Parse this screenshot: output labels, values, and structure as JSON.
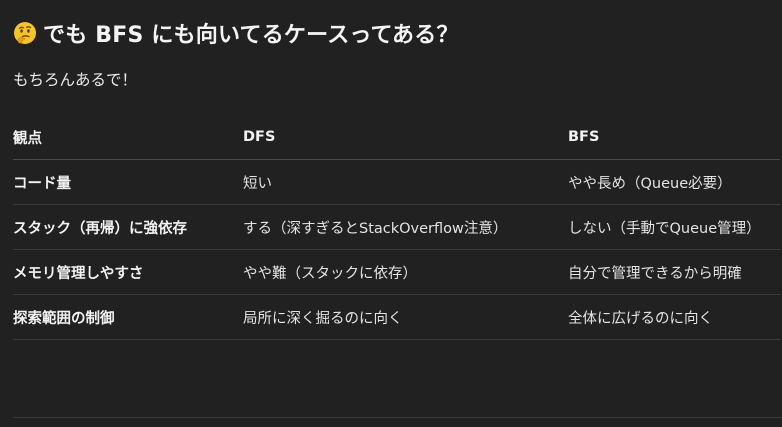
{
  "heading": {
    "emoji": "thinking-face-icon",
    "text": "でも BFS にも向いてるケースってある？"
  },
  "intro": "もちろんあるで！",
  "table": {
    "headers": [
      "観点",
      "DFS",
      "BFS"
    ],
    "rows": [
      [
        "コード量",
        "短い",
        "やや長め（Queue必要）"
      ],
      [
        "スタック（再帰）に強依存",
        "する（深すぎるとStackOverflow注意）",
        "しない（手動でQueue管理）"
      ],
      [
        "メモリ管理しやすさ",
        "やや難（スタックに依存）",
        "自分で管理できるから明確"
      ],
      [
        "探索範囲の制御",
        "局所に深く掘るのに向く",
        "全体に広げるのに向く"
      ]
    ]
  },
  "colors": {
    "background": "#212121",
    "text": "#ececec",
    "divider": "#3c3c3c"
  }
}
